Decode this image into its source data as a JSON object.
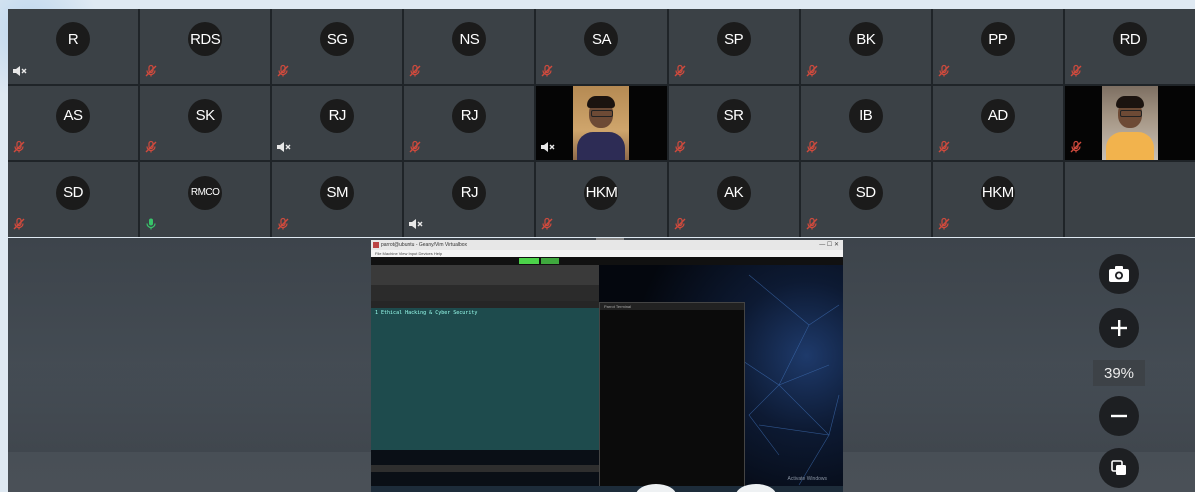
{
  "participants": [
    {
      "initials": "R",
      "status": "speaker-muted"
    },
    {
      "initials": "RDS",
      "status": "mic-muted"
    },
    {
      "initials": "SG",
      "status": "mic-muted"
    },
    {
      "initials": "NS",
      "status": "mic-muted"
    },
    {
      "initials": "SA",
      "status": "mic-muted"
    },
    {
      "initials": "SP",
      "status": "mic-muted"
    },
    {
      "initials": "BK",
      "status": "mic-muted"
    },
    {
      "initials": "PP",
      "status": "mic-muted"
    },
    {
      "initials": "RD",
      "status": "mic-muted"
    },
    {
      "initials": "AS",
      "status": "mic-muted"
    },
    {
      "initials": "SK",
      "status": "mic-muted"
    },
    {
      "initials": "RJ",
      "status": "speaker-muted"
    },
    {
      "initials": "RJ",
      "status": "mic-muted"
    },
    {
      "initials": "",
      "status": "speaker-muted",
      "video": 1
    },
    {
      "initials": "SR",
      "status": "mic-muted"
    },
    {
      "initials": "IB",
      "status": "mic-muted"
    },
    {
      "initials": "AD",
      "status": "mic-muted"
    },
    {
      "initials": "",
      "status": "mic-muted",
      "video": 2
    },
    {
      "initials": "SD",
      "status": "mic-muted"
    },
    {
      "initials": "RMCO",
      "status": "mic-on"
    },
    {
      "initials": "SM",
      "status": "mic-muted"
    },
    {
      "initials": "RJ",
      "status": "speaker-muted"
    },
    {
      "initials": "HKM",
      "status": "mic-muted"
    },
    {
      "initials": "AK",
      "status": "mic-muted"
    },
    {
      "initials": "SD",
      "status": "mic-muted"
    },
    {
      "initials": "HKM",
      "status": "mic-muted"
    },
    {
      "initials": "",
      "status": "none",
      "empty": true
    }
  ],
  "shared_screen": {
    "window_title": "parrot@ubuntu - Geany/Vim Virtualbox",
    "menu": "File  Machine  View  Input  Devices  Help",
    "editor_line": "1 Ethical Hacking & Cyber Security",
    "terminal_title": "Parrot Terminal",
    "watermark": "Activate Windows"
  },
  "zoom": {
    "value": "39%"
  },
  "icons": {
    "camera": "camera-icon",
    "plus": "zoom-in-icon",
    "minus": "zoom-out-icon",
    "layers": "copy-screen-icon",
    "mic_muted": "mic-muted-icon",
    "mic_on": "mic-on-icon",
    "speaker_muted": "speaker-muted-icon"
  },
  "colors": {
    "mic_muted": "#c0392b",
    "mic_on": "#2ecc40",
    "tile_bg": "#3b4146"
  }
}
